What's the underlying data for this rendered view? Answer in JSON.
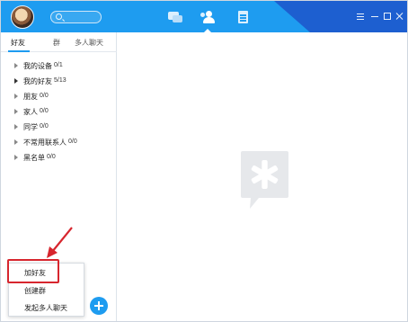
{
  "tabs": {
    "friends": "好友",
    "groups": "群",
    "multi_chat": "多人聊天"
  },
  "contacts": [
    {
      "label": "我的设备",
      "count": "0/1"
    },
    {
      "label": "我的好友",
      "count": "5/13"
    },
    {
      "label": "朋友",
      "count": "0/0"
    },
    {
      "label": "家人",
      "count": "0/0"
    },
    {
      "label": "同学",
      "count": "0/0"
    },
    {
      "label": "不常用联系人",
      "count": "0/0"
    },
    {
      "label": "黑名单",
      "count": "0/0"
    }
  ],
  "popup_menu": {
    "items": [
      "加好友",
      "创建群",
      "发起多人聊天"
    ]
  },
  "colors": {
    "accent": "#1e9cf0",
    "header_dark": "#1d5fd0",
    "highlight": "#d7262e"
  },
  "icons": {
    "search": "search-icon",
    "chat": "chat-icon",
    "contacts": "contacts-icon",
    "docs": "docs-icon",
    "add": "plus-icon",
    "placeholder_logo": "asterisk-logo-icon"
  }
}
